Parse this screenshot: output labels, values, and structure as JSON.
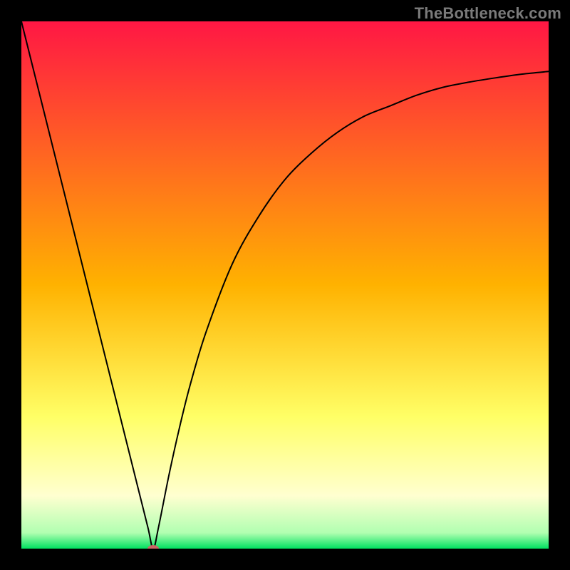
{
  "watermark": "TheBottleneck.com",
  "chart_data": {
    "type": "line",
    "title": "",
    "xlabel": "",
    "ylabel": "",
    "xlim": [
      0,
      100
    ],
    "ylim": [
      0,
      100
    ],
    "grid": false,
    "legend": false,
    "background_gradient": {
      "stops": [
        {
          "pos": 0.0,
          "color": "#ff1744"
        },
        {
          "pos": 0.5,
          "color": "#ffb200"
        },
        {
          "pos": 0.75,
          "color": "#ffff66"
        },
        {
          "pos": 0.9,
          "color": "#ffffd0"
        },
        {
          "pos": 0.97,
          "color": "#b1ffb1"
        },
        {
          "pos": 1.0,
          "color": "#00e060"
        }
      ]
    },
    "series": [
      {
        "name": "curve",
        "color": "#000000",
        "stroke_width": 2,
        "x": [
          0,
          2,
          4,
          6,
          8,
          10,
          12,
          14,
          16,
          18,
          20,
          22,
          24,
          25,
          26,
          28,
          30,
          32,
          35,
          40,
          45,
          50,
          55,
          60,
          65,
          70,
          75,
          80,
          85,
          90,
          95,
          100
        ],
        "y": [
          100,
          92,
          84,
          76,
          68,
          60,
          52,
          44,
          36,
          28,
          20,
          12,
          4,
          0,
          4,
          14,
          23,
          31,
          41,
          54,
          63,
          70,
          75,
          79,
          82,
          84,
          86,
          87.5,
          88.5,
          89.3,
          90,
          90.5
        ]
      }
    ],
    "marker": {
      "x": 25,
      "y": 0,
      "color": "#cc6666",
      "rx": 8,
      "ry": 5
    }
  }
}
